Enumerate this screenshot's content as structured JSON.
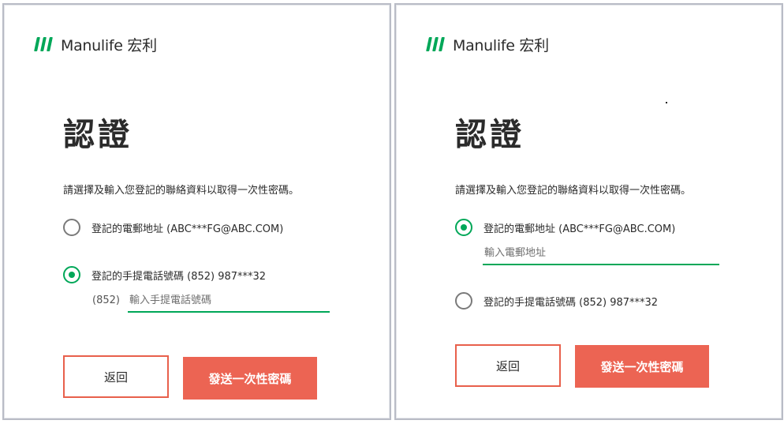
{
  "brand": {
    "name": "Manulife 宏利",
    "accent_color": "#00a758",
    "logo_icon": "manulife-stripes-icon"
  },
  "screens": [
    {
      "title": "認證",
      "instruction": "請選擇及輸入您登記的聯絡資料以取得一次性密碼。",
      "options": [
        {
          "label": "登記的電郵地址 (ABC***FG@ABC.COM)",
          "selected": false
        },
        {
          "label": "登記的手提電話號碼 (852) 987***32",
          "selected": true
        }
      ],
      "phone_input": {
        "prefix": "(852)",
        "placeholder": "輸入手提電話號碼",
        "value": ""
      },
      "buttons": {
        "back": "返回",
        "send": "發送一次性密碼"
      }
    },
    {
      "title": "認證",
      "instruction": "請選擇及輸入您登記的聯絡資料以取得一次性密碼。",
      "options": [
        {
          "label": "登記的電郵地址 (ABC***FG@ABC.COM)",
          "selected": true
        },
        {
          "label": "登記的手提電話號碼 (852) 987***32",
          "selected": false
        }
      ],
      "email_input": {
        "placeholder": "輸入電郵地址",
        "value": ""
      },
      "buttons": {
        "back": "返回",
        "send": "發送一次性密碼"
      }
    }
  ],
  "colors": {
    "button_primary": "#ec6453",
    "button_outline": "#e8604c",
    "input_underline": "#00a758"
  }
}
